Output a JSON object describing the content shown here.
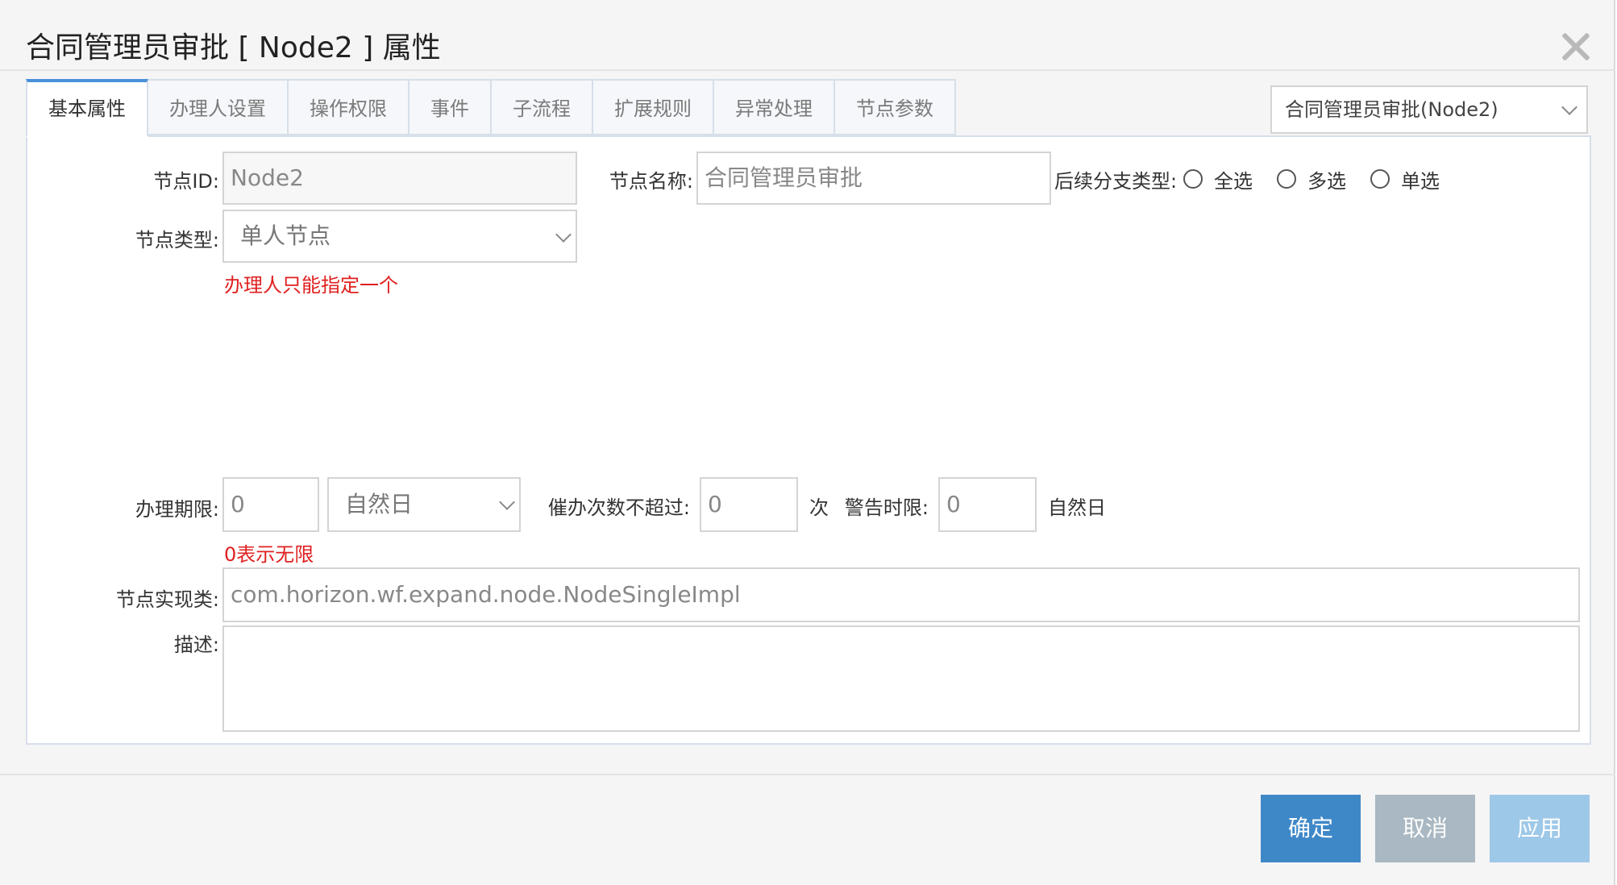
{
  "dialog": {
    "title": "合同管理员审批 [ Node2 ] 属性"
  },
  "tabs": [
    {
      "label": "基本属性",
      "active": true
    },
    {
      "label": "办理人设置"
    },
    {
      "label": "操作权限"
    },
    {
      "label": "事件"
    },
    {
      "label": "子流程"
    },
    {
      "label": "扩展规则"
    },
    {
      "label": "异常处理"
    },
    {
      "label": "节点参数"
    }
  ],
  "node_selector": {
    "value": "合同管理员审批(Node2)"
  },
  "form": {
    "node_id_label": "节点ID:",
    "node_id_value": "Node2",
    "node_name_label": "节点名称:",
    "node_name_value": "合同管理员审批",
    "branch_type_label": "后续分支类型:",
    "branch_options": [
      "全选",
      "多选",
      "单选"
    ],
    "node_type_label": "节点类型:",
    "node_type_value": "单人节点",
    "node_type_hint": "办理人只能指定一个",
    "deadline_label": "办理期限:",
    "deadline_value": "0",
    "deadline_unit": "自然日",
    "deadline_hint": "0表示无限",
    "urge_label": "催办次数不超过:",
    "urge_value": "0",
    "urge_unit": "次",
    "warn_label": "警告时限:",
    "warn_value": "0",
    "warn_unit": "自然日",
    "impl_label": "节点实现类:",
    "impl_value": "com.horizon.wf.expand.node.NodeSingleImpl",
    "desc_label": "描述:",
    "desc_value": ""
  },
  "buttons": {
    "ok": "确定",
    "cancel": "取消",
    "apply": "应用"
  },
  "colors": {
    "ok": "#3f88c8",
    "cancel": "#a9b8c2",
    "apply": "#9ec8e8",
    "hint": "#e02020",
    "tab_active_border": "#4a90d9"
  }
}
